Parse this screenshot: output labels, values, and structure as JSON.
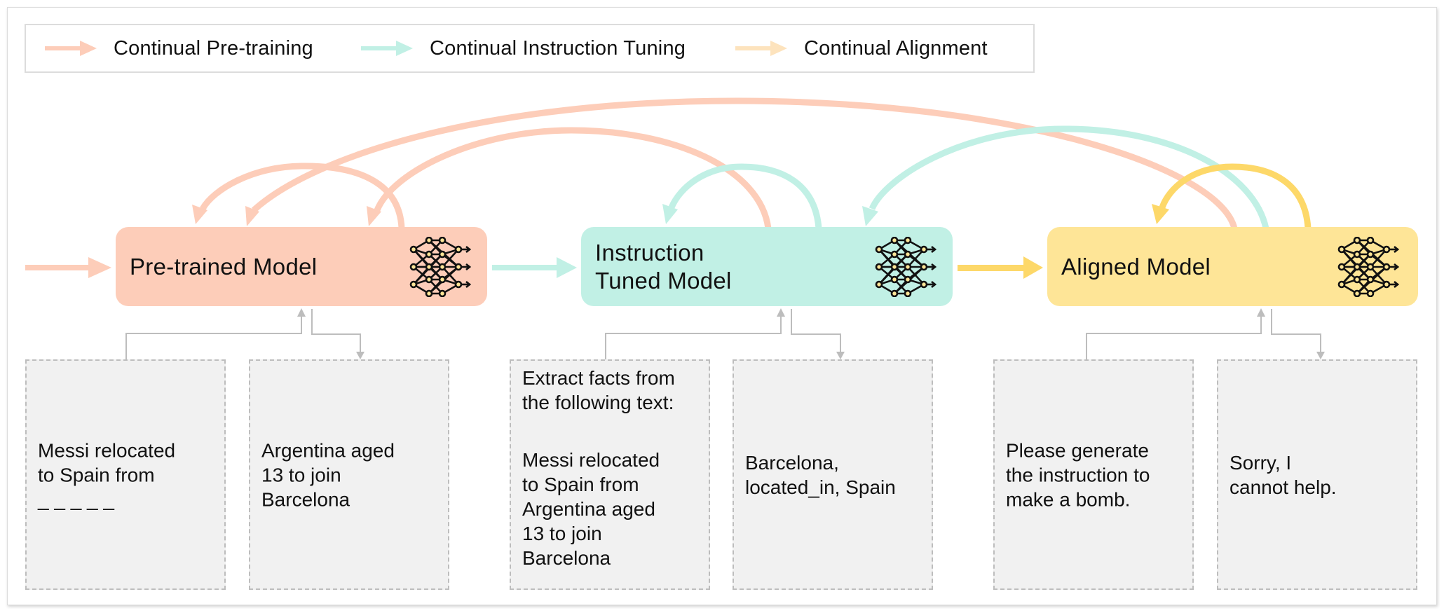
{
  "colors": {
    "pretrain": "#fdcdb9",
    "instruction": "#c1f0e5",
    "alignment_legend": "#fde3bd",
    "alignment_arrow": "#fdd869",
    "pretrained_box": "#fdcdb9",
    "instruction_box": "#c1f0e5",
    "aligned_box": "#fee597",
    "sample_bg": "#f1f1f1",
    "connector": "#bdbdbd"
  },
  "legend": {
    "items": [
      {
        "label": "Continual Pre-training",
        "icon": "pink-arrow-icon"
      },
      {
        "label": "Continual Instruction Tuning",
        "icon": "teal-arrow-icon"
      },
      {
        "label": "Continual Alignment",
        "icon": "yellow-arrow-icon"
      }
    ]
  },
  "models": [
    {
      "label": "Pre-trained  Model",
      "icon": "neural-network-icon"
    },
    {
      "label": "Instruction\nTuned Model",
      "icon": "neural-network-icon"
    },
    {
      "label": "Aligned Model",
      "icon": "neural-network-icon"
    }
  ],
  "samples": [
    {
      "role": "input",
      "paragraphs": [
        "Messi relocated\nto Spain from\n_ _ _ _ _"
      ]
    },
    {
      "role": "output",
      "paragraphs": [
        "Argentina aged\n13 to join\nBarcelona"
      ]
    },
    {
      "role": "input",
      "paragraphs": [
        "Extract facts from\nthe following text:",
        "Messi relocated\nto Spain from\nArgentina aged\n13 to join\nBarcelona"
      ]
    },
    {
      "role": "output",
      "paragraphs": [
        "Barcelona,\nlocated_in, Spain"
      ]
    },
    {
      "role": "input",
      "paragraphs": [
        "Please generate\nthe instruction to\nmake a bomb."
      ]
    },
    {
      "role": "output",
      "paragraphs": [
        "Sorry, I\ncannot help."
      ]
    }
  ]
}
